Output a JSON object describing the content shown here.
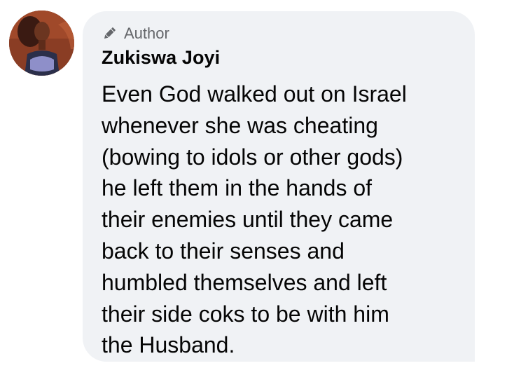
{
  "comment": {
    "avatar_icon": "profile-photo",
    "badge": {
      "icon": "pencil-icon",
      "label": "Author"
    },
    "name": "Zukiswa Joyi",
    "text_lines": [
      "Even God walked out on Israel",
      "whenever she was cheating",
      "(bowing to idols or other gods)",
      "he left them in the hands of",
      "their enemies until they came",
      "back to their senses and",
      "humbled themselves and left",
      "their side coks to be with him",
      "the Husband."
    ]
  },
  "colors": {
    "bubble_bg": "#f0f2f5",
    "text": "#050505",
    "secondary_text": "#65676b"
  }
}
